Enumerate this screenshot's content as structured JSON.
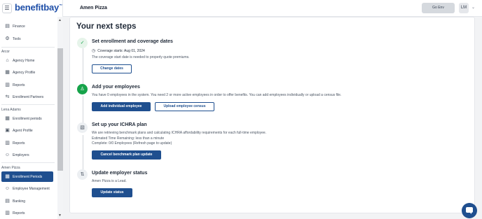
{
  "app": {
    "logo_text": "benefitbay",
    "logo_tm": "™",
    "menu_icon": "☰"
  },
  "colors": {
    "brand_primary": "#1f4f8f",
    "success": "#16a34a"
  },
  "header": {
    "company": "Amen Pizza",
    "go_env_label": "Go Env",
    "avatar_initials": "LM",
    "chevron": "⌄"
  },
  "sidebar": {
    "items": [
      {
        "label": "Finance",
        "icon": "bank-icon",
        "glyph": "▤"
      },
      {
        "label": "Tools",
        "icon": "gear-icon",
        "glyph": "⚙"
      }
    ],
    "sections": [
      {
        "label": "Arcor",
        "items": [
          {
            "label": "Agency Home",
            "icon": "building-icon",
            "glyph": "⌂"
          },
          {
            "label": "Agency Profile",
            "icon": "profile-icon",
            "glyph": "▦"
          },
          {
            "label": "Reports",
            "icon": "report-icon",
            "glyph": "▥"
          },
          {
            "label": "Enrollment Partners",
            "icon": "partners-icon",
            "glyph": "⇆"
          }
        ]
      },
      {
        "label": "Lena Adams",
        "items": [
          {
            "label": "Enrollment periods",
            "icon": "calendar-icon",
            "glyph": "▦"
          },
          {
            "label": "Agent Profile",
            "icon": "id-card-icon",
            "glyph": "▣"
          },
          {
            "label": "Reports",
            "icon": "report-icon",
            "glyph": "▥"
          },
          {
            "label": "Employers",
            "icon": "people-icon",
            "glyph": "☺"
          }
        ]
      },
      {
        "label": "Amen Pizza",
        "items": [
          {
            "label": "Enrollment Periods",
            "icon": "calendar-icon",
            "glyph": "▦",
            "active": true
          },
          {
            "label": "Employee Management",
            "icon": "people-icon",
            "glyph": "☺"
          },
          {
            "label": "Banking",
            "icon": "bank-card-icon",
            "glyph": "▤"
          },
          {
            "label": "Reports",
            "icon": "report-icon",
            "glyph": "▥"
          }
        ]
      }
    ],
    "scroll_up": "▲",
    "scroll_down": "▼"
  },
  "main": {
    "title": "Your next steps",
    "steps": [
      {
        "icon": "check-icon",
        "glyph": "✓",
        "title": "Set enrollment and coverage dates",
        "lines": [
          "Coverage starts: Aug 01, 2024",
          "The coverage start date is needed to properly quote premiums."
        ],
        "clock_glyph": "◷",
        "buttons": [
          "Change dates"
        ]
      },
      {
        "icon": "user-icon",
        "glyph": "♙",
        "title": "Add your employees",
        "lines": [
          "You have 0 employees in the system. You need 2 or more active employees in order to offer benefits. You can add employees individually or upload a census file."
        ],
        "buttons": [
          "Add individual employee",
          "Upload employee census"
        ]
      },
      {
        "icon": "document-icon",
        "glyph": "▧",
        "title": "Set up your ICHRA plan",
        "lines": [
          "We are retrieving benchmark plans and calculating ICHRA affordability requirements for each full-time employee.",
          "Estimated Time Remaining: less than a minute",
          "Complete: 0/0 Employees (Refresh page to update)"
        ],
        "buttons": [
          "Cancel benchmark plan update"
        ]
      },
      {
        "icon": "status-icon",
        "glyph": "⇅",
        "title": "Update employer status",
        "lines": [
          "Amen Pizza is a Lead."
        ],
        "buttons": [
          "Update status"
        ]
      }
    ]
  }
}
